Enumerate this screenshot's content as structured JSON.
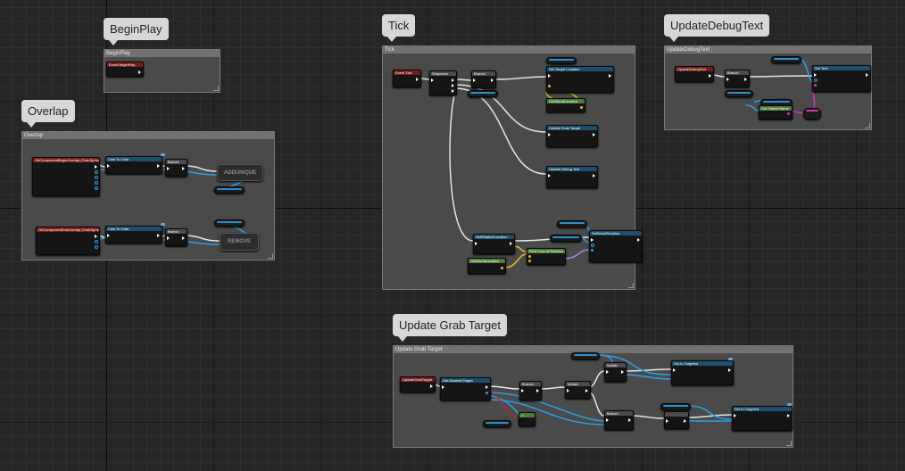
{
  "comments": {
    "beginplay": {
      "bubble": "BeginPlay",
      "header": "BeginPlay"
    },
    "overlap": {
      "bubble": "Overlap",
      "header": "Overlap"
    },
    "tick": {
      "bubble": "Tick",
      "header": "Tick"
    },
    "debug": {
      "bubble": "UpdateDebugText",
      "header": "UpdateDebugText"
    },
    "grab": {
      "bubble": "Update Grab Target",
      "header": "Update Grab Target"
    }
  },
  "nodes": {
    "event_beginplay": "Event BeginPlay",
    "overlap_begin": "OnComponentBeginOverlap (GrabSphere)",
    "overlap_end": "OnComponentEndOverlap (GrabSphere)",
    "cast1": "Cast To Grab",
    "cast2": "Cast To Grab",
    "branch1": "Branch",
    "branch2": "Branch",
    "add_unique": "ADDUNIQUE",
    "remove": "REMOVE",
    "event_tick": "Event Tick",
    "sequence": "Sequence",
    "tick_branch": "Branch",
    "set_world_location": "Set Target Location",
    "get_world_location": "GetWorldLocation",
    "update_grab_target": "Update Grab Target",
    "update_debug_text": "Update Debug Text",
    "set_rel_location": "SetRelativeLocation",
    "tick_loc": "GetWorldLocation",
    "find_look": "Find Look at Rotation",
    "set_world_rotation": "SetWorldRotation",
    "debug_event": "UpdateDebugText",
    "debug_branch": "Branch",
    "debug_set_text": "Set Text",
    "debug_get_name": "Get Object Name",
    "grab_event": "UpdateGrabTarget",
    "grab_get": "Get Nearest Target",
    "grab_branch": "Branch",
    "grab_isvalid": "IsValid",
    "grab_set1": "Set In Targeted",
    "grab_set2": "Set In Targeted",
    "grab_notequal": "!=",
    "grab_valid2": "IsValid",
    "grab_branch2": "Branch"
  },
  "colors": {
    "event": "#7a1b1b",
    "function": "#1f4f6e",
    "pure": "#4d7a3a",
    "exec_wire": "#e6e6e6",
    "object_wire": "#2aa0e6",
    "vector_wire": "#e0c020",
    "string_wire": "#d03aa9",
    "rotator_wire": "#9a8ce0"
  }
}
